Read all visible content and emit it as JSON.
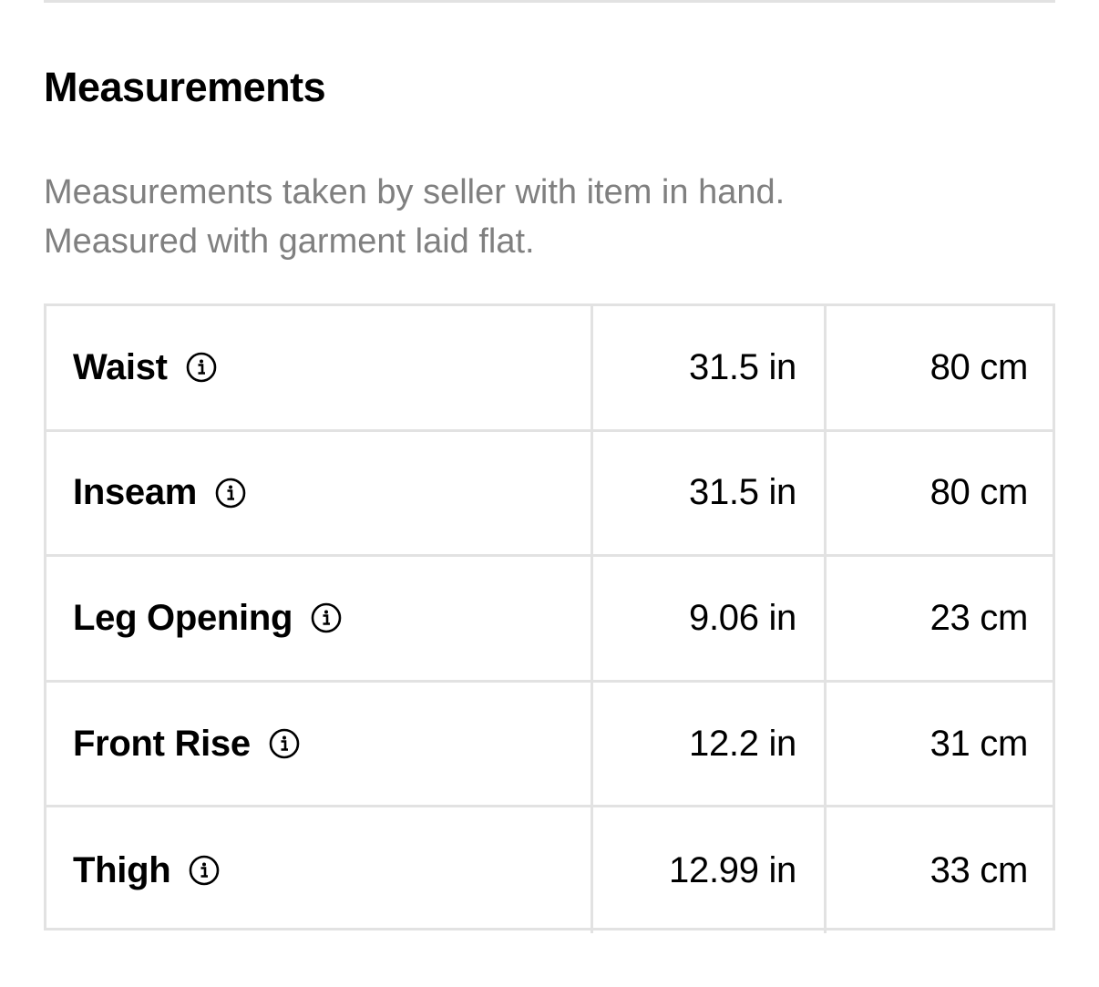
{
  "section": {
    "title": "Measurements",
    "note_line1": "Measurements taken by seller with item in hand.",
    "note_line2": "Measured with garment laid flat."
  },
  "measurements": [
    {
      "label": "Waist",
      "inches": "31.5 in",
      "centimeters": "80 cm",
      "icon": "info-icon"
    },
    {
      "label": "Inseam",
      "inches": "31.5 in",
      "centimeters": "80 cm",
      "icon": "info-icon"
    },
    {
      "label": "Leg Opening",
      "inches": "9.06 in",
      "centimeters": "23 cm",
      "icon": "info-icon"
    },
    {
      "label": "Front Rise",
      "inches": "12.2 in",
      "centimeters": "31 cm",
      "icon": "info-icon"
    },
    {
      "label": "Thigh",
      "inches": "12.99 in",
      "centimeters": "33 cm",
      "icon": "info-icon"
    }
  ],
  "colors": {
    "text": "#000000",
    "muted_text": "#808080",
    "border": "#e2e2e2",
    "background": "#ffffff"
  }
}
